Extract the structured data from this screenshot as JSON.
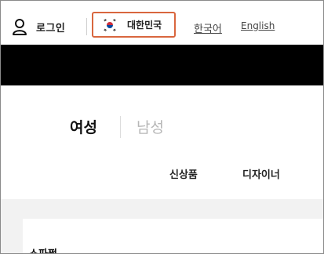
{
  "utility": {
    "login_label": "로그인",
    "country_label": "대한민국",
    "languages": [
      "한국어",
      "English"
    ]
  },
  "nav": {
    "gender_tabs": [
      "여성",
      "남성"
    ],
    "categories": [
      "신상품",
      "디자이너"
    ]
  },
  "content": {
    "card_title": "스파쩍"
  },
  "colors": {
    "country_border": "#d9663e",
    "band": "#000000",
    "inactive_tab": "#b7b7b7",
    "lower_bg": "#f2f2f2"
  },
  "icons": {
    "login": "user-icon",
    "country": "korea-flag-icon"
  }
}
